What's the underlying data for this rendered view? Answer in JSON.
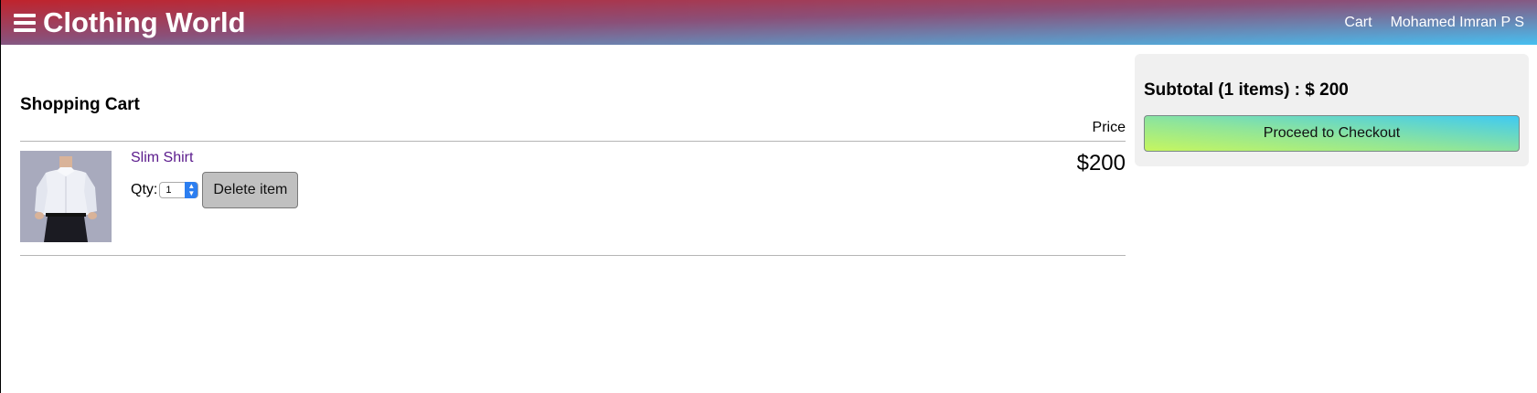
{
  "header": {
    "brand": "Clothing World",
    "links": {
      "cart": "Cart",
      "user": "Mohamed Imran P S"
    }
  },
  "cart": {
    "title": "Shopping Cart",
    "price_heading": "Price",
    "items": [
      {
        "name": "Slim Shirt",
        "qty_label": "Qty:",
        "qty": "1",
        "delete_label": "Delete item",
        "price": "$200"
      }
    ]
  },
  "summary": {
    "subtotal": "Subtotal (1 items) : $ 200",
    "checkout_label": "Proceed to Checkout"
  },
  "colors": {
    "link": "#5a1a8c",
    "header_gradient": [
      "#c0232c",
      "#47bff0"
    ],
    "checkout_gradient": [
      "#c6f65f",
      "#3fcaf3"
    ]
  }
}
